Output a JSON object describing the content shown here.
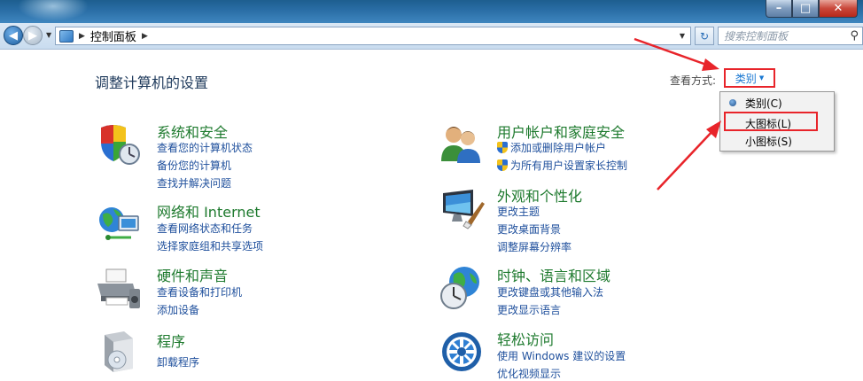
{
  "window": {
    "buttons": {
      "minimize": "–",
      "maximize": "□",
      "close": "✕"
    }
  },
  "address_bar": {
    "path": [
      "控制面板"
    ],
    "search_placeholder": "搜索控制面板"
  },
  "header": {
    "title": "调整计算机的设置",
    "view_by_label": "查看方式:",
    "view_selected": "类别"
  },
  "view_menu": {
    "items": [
      "类别(C)",
      "大图标(L)",
      "小图标(S)"
    ],
    "selected_index": 0
  },
  "categories": [
    {
      "title": "系统和安全",
      "links": [
        "查看您的计算机状态",
        "备份您的计算机",
        "查找并解决问题"
      ],
      "icon": "shield-icon"
    },
    {
      "title": "网络和 Internet",
      "links": [
        "查看网络状态和任务",
        "选择家庭组和共享选项"
      ],
      "icon": "network-globe-icon"
    },
    {
      "title": "硬件和声音",
      "links": [
        "查看设备和打印机",
        "添加设备"
      ],
      "icon": "printer-icon"
    },
    {
      "title": "程序",
      "links": [
        "卸载程序"
      ],
      "icon": "program-box-icon"
    },
    {
      "title": "用户帐户和家庭安全",
      "links": [
        "添加或删除用户帐户",
        "为所有用户设置家长控制"
      ],
      "icon": "users-icon"
    },
    {
      "title": "外观和个性化",
      "links": [
        "更改主题",
        "更改桌面背景",
        "调整屏幕分辨率"
      ],
      "icon": "monitor-brush-icon"
    },
    {
      "title": "时钟、语言和区域",
      "links": [
        "更改键盘或其他输入法",
        "更改显示语言"
      ],
      "icon": "clock-globe-icon"
    },
    {
      "title": "轻松访问",
      "links": [
        "使用 Windows 建议的设置",
        "优化视频显示"
      ],
      "icon": "ease-of-access-icon"
    }
  ],
  "colors": {
    "category_title": "#1e7a2e",
    "link": "#1e4f9c",
    "annotation": "#e8242a"
  }
}
